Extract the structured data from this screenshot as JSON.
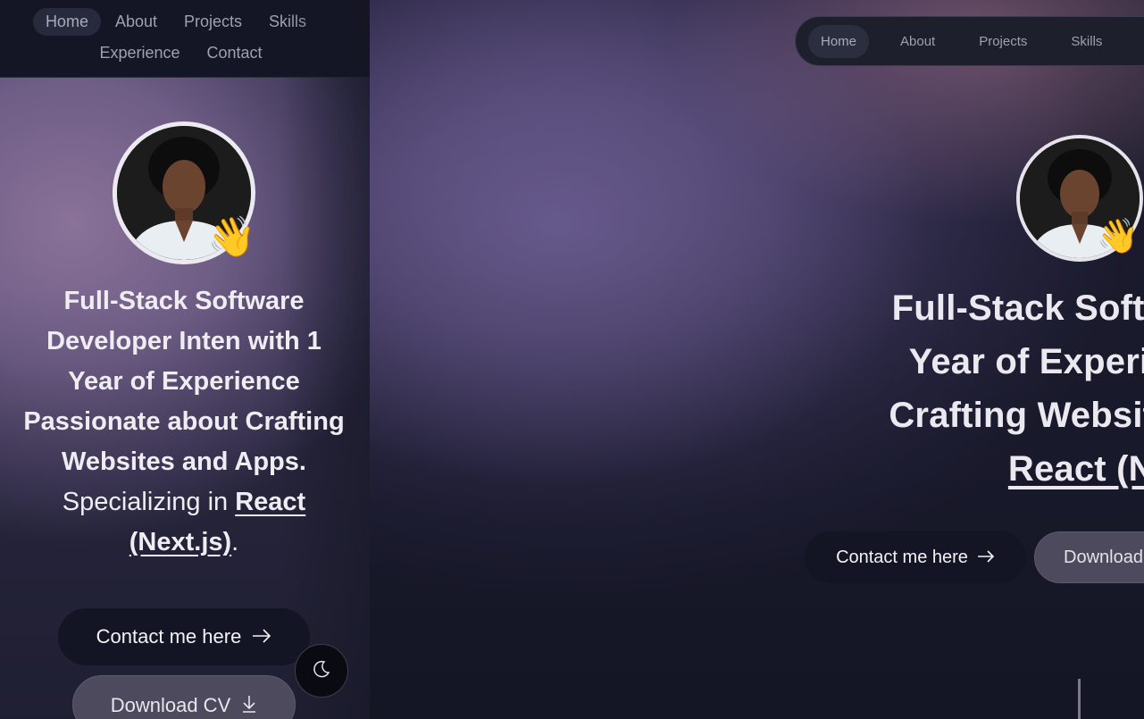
{
  "nav": {
    "items": [
      "Home",
      "About",
      "Projects",
      "Skills",
      "Experience",
      "Contact"
    ],
    "active": "Home"
  },
  "mobile": {
    "headline_bold": "Full-Stack Software Developer Inten with 1 Year of Experience Passionate about Crafting Websites and Apps.",
    "headline_plain": " Specializing in ",
    "headline_link": "React (Next.js)",
    "headline_end": ".",
    "contact_label": "Contact me here",
    "download_label": "Download CV"
  },
  "desktop": {
    "line1": "Full-Stack Software Deve",
    "line2": "Year of Experience Pas",
    "line3": "Crafting Websites and Ap",
    "line4": "React (Next",
    "contact_label": "Contact me here",
    "download_label": "Download"
  },
  "icons": {
    "wave": "👋",
    "arrow": "arrow-right-icon",
    "download": "download-icon",
    "theme": "moon-icon"
  },
  "colors": {
    "button_dark": "#131524",
    "button_gray": "#4c4a5c",
    "nav_bg": "#141625",
    "text_light": "#efecf2"
  }
}
